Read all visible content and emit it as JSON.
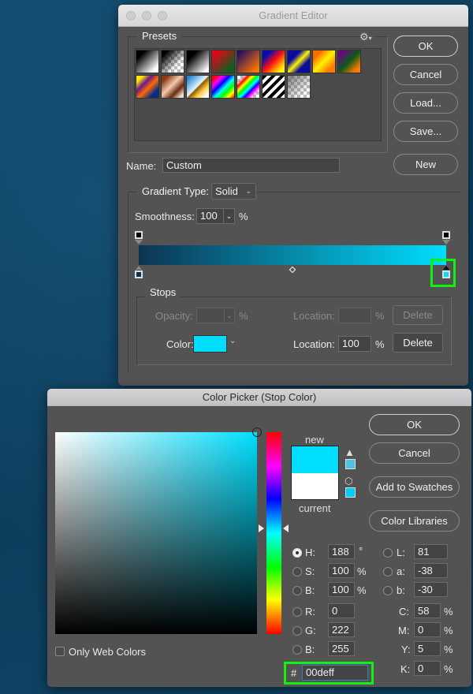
{
  "gradient_editor": {
    "title": "Gradient Editor",
    "presets_label": "Presets",
    "presets_menu_icon": "gear-icon",
    "presets": [
      {
        "name": "black-white",
        "css": "linear-gradient(135deg,#000 20%,#fff 85%)"
      },
      {
        "name": "black-transparent",
        "css": "linear-gradient(135deg,#000 15%,rgba(0,0,0,0) 70%)",
        "checker": true
      },
      {
        "name": "black-white-2",
        "css": "linear-gradient(135deg,#000 25%,#fff 90%)"
      },
      {
        "name": "red-green",
        "css": "linear-gradient(135deg,#e0061a 15%,#0c6020 85%)"
      },
      {
        "name": "violet-orange",
        "css": "linear-gradient(135deg,#2a0e5e 10%,#ff7a00 90%)"
      },
      {
        "name": "blue-red-yellow",
        "css": "linear-gradient(135deg,#0a0ab0 20%,#ff1010 50%,#ffee00 85%)"
      },
      {
        "name": "blue-yellow-blue",
        "css": "linear-gradient(135deg,#0c0c9c 30%,#fff200 50%,#0c0c9c 70%)"
      },
      {
        "name": "orange-yellow-orange",
        "css": "linear-gradient(135deg,#ff6a00 20%,#fff200 50%,#ff7a00 80%)"
      },
      {
        "name": "violet-green-orange",
        "css": "linear-gradient(135deg,#6a0a7a 15%,#0a5a1a 50%,#ff7a00 85%)"
      },
      {
        "name": "stripes-yellow-violet",
        "css": "linear-gradient(135deg,#ffe600 15%,#6a1a8a 35%,#ff6a00 55%,#0a2a8a 80%)"
      },
      {
        "name": "copper",
        "css": "linear-gradient(135deg,#8a3a10 15%,#f5c8b0 45%,#6a2a10 70%,#f0dcd0 90%)"
      },
      {
        "name": "chrome",
        "css": "linear-gradient(135deg,#2a8ad0 10%,#e6f4ff 48%,#8a5a00 52%,#ffcc44 70%,#ffffff 90%)"
      },
      {
        "name": "spectrum",
        "css": "linear-gradient(135deg,#ff0000 10%,#ff00ff 25%,#0000ff 40%,#00ffff 55%,#00ff00 70%,#ffff00 85%,#ff0000 100%)"
      },
      {
        "name": "transparent-rainbow",
        "css": "linear-gradient(135deg,transparent 15%,#ff0000 25%,#ffff00 35%,#00ff00 45%,#00ffff 55%,#0000ff 65%,#ff00ff 72%,transparent 85%)",
        "checker": true
      },
      {
        "name": "transparent-stripes",
        "css": "repeating-linear-gradient(135deg,#000 0 4px,#fff 4px 8px)"
      },
      {
        "name": "neutral-density",
        "css": "linear-gradient(135deg,rgba(90,90,90,0.8) 0%,rgba(255,255,255,0) 80%)",
        "checker": true
      }
    ],
    "buttons": {
      "ok": "OK",
      "cancel": "Cancel",
      "load": "Load...",
      "save": "Save...",
      "new": "New"
    },
    "name_label": "Name:",
    "name_value": "Custom",
    "gradient_type_label": "Gradient Type:",
    "gradient_type_value": "Solid",
    "smoothness_label": "Smoothness:",
    "smoothness_value": "100",
    "smoothness_unit": "%",
    "gradient": {
      "start_color": "#0c3452",
      "end_color": "#00deff",
      "midpoint_percent": 50
    },
    "color_stops": [
      {
        "color": "#0c3452",
        "location_percent": 0,
        "selected": false
      },
      {
        "color": "#00deff",
        "location_percent": 100,
        "selected": true
      }
    ],
    "opacity_stops": [
      {
        "opacity_percent": 100,
        "location_percent": 0
      },
      {
        "opacity_percent": 100,
        "location_percent": 100
      }
    ],
    "stops": {
      "legend": "Stops",
      "opacity_label": "Opacity:",
      "opacity_value": "",
      "opacity_unit": "%",
      "opacity_location_label": "Location:",
      "opacity_location_value": "",
      "opacity_location_unit": "%",
      "opacity_delete": "Delete",
      "color_label": "Color:",
      "color_value": "#00deff",
      "color_location_label": "Location:",
      "color_location_value": "100",
      "color_location_unit": "%",
      "color_delete": "Delete"
    }
  },
  "color_picker": {
    "title": "Color Picker (Stop Color)",
    "hue_color": "#00deff",
    "new_label": "new",
    "current_label": "current",
    "new_color": "#00deff",
    "current_color": "#ffffff",
    "gamut_warning_icon": "warning-icon",
    "gamut_swatch": "#4fc3e6",
    "web_safe_icon": "cube-icon",
    "web_safe_swatch": "#00ccff",
    "buttons": {
      "ok": "OK",
      "cancel": "Cancel",
      "add_to_swatches": "Add to Swatches",
      "color_libraries": "Color Libraries"
    },
    "hsb": {
      "h": {
        "label": "H:",
        "value": "188",
        "unit": "°",
        "selected": true
      },
      "s": {
        "label": "S:",
        "value": "100",
        "unit": "%"
      },
      "b": {
        "label": "B:",
        "value": "100",
        "unit": "%"
      }
    },
    "rgb": {
      "r": {
        "label": "R:",
        "value": "0"
      },
      "g": {
        "label": "G:",
        "value": "222"
      },
      "b": {
        "label": "B:",
        "value": "255"
      }
    },
    "lab": {
      "l": {
        "label": "L:",
        "value": "81"
      },
      "a": {
        "label": "a:",
        "value": "-38"
      },
      "b": {
        "label": "b:",
        "value": "-30"
      }
    },
    "cmyk": {
      "c": {
        "label": "C:",
        "value": "58",
        "unit": "%"
      },
      "m": {
        "label": "M:",
        "value": "0",
        "unit": "%"
      },
      "y": {
        "label": "Y:",
        "value": "5",
        "unit": "%"
      },
      "k": {
        "label": "K:",
        "value": "0",
        "unit": "%"
      }
    },
    "hex_label": "#",
    "hex_value": "00deff",
    "only_web_colors_label": "Only Web Colors",
    "only_web_colors_checked": false,
    "hue_slider_value_deg": 188
  },
  "highlight_color": "#12f012"
}
